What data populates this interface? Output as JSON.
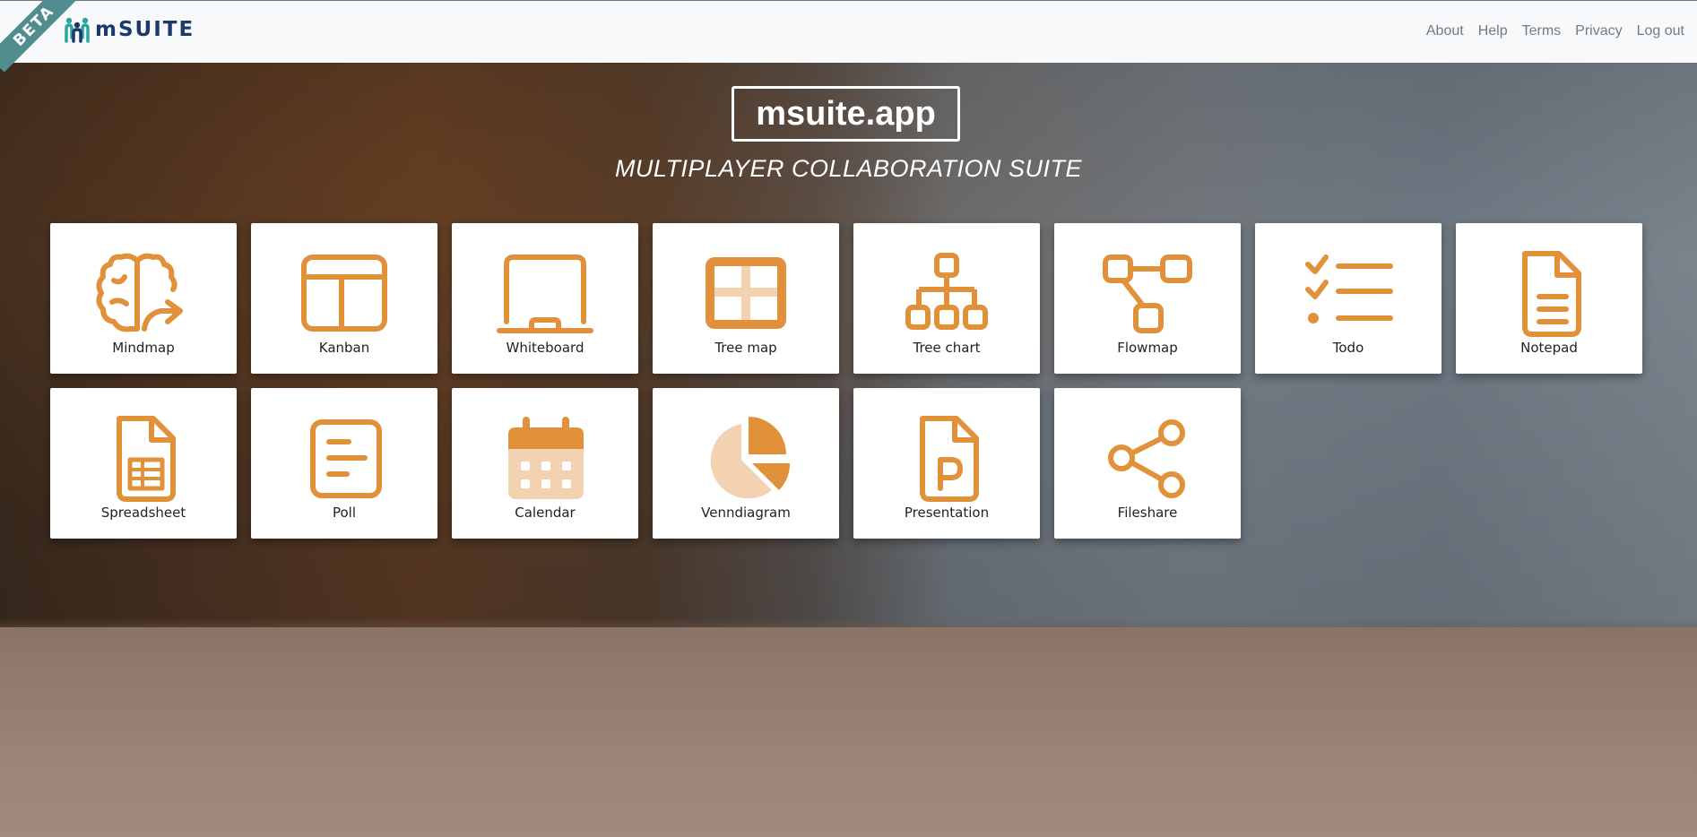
{
  "header": {
    "ribbon": "BETA",
    "logo_text": "mSUITE",
    "logo_icon": "people-logo-icon",
    "nav": [
      "About",
      "Help",
      "Terms",
      "Privacy",
      "Log out"
    ]
  },
  "hero": {
    "title": "msuite.app",
    "tagline": "MULTIPLAYER COLLABORATION SUITE"
  },
  "colors": {
    "accent": "#e0913a",
    "accent_light": "#f3d2b2",
    "brand": "#1b3a6b",
    "brand_teal": "#2aa6a1"
  },
  "apps": [
    {
      "label": "Mindmap",
      "icon": "brain-icon"
    },
    {
      "label": "Kanban",
      "icon": "kanban-board-icon"
    },
    {
      "label": "Whiteboard",
      "icon": "whiteboard-icon"
    },
    {
      "label": "Tree map",
      "icon": "treemap-icon"
    },
    {
      "label": "Tree chart",
      "icon": "tree-chart-icon"
    },
    {
      "label": "Flowmap",
      "icon": "flowmap-icon"
    },
    {
      "label": "Todo",
      "icon": "checklist-icon"
    },
    {
      "label": "Notepad",
      "icon": "document-icon"
    },
    {
      "label": "Spreadsheet",
      "icon": "spreadsheet-icon"
    },
    {
      "label": "Poll",
      "icon": "poll-icon"
    },
    {
      "label": "Calendar",
      "icon": "calendar-icon"
    },
    {
      "label": "Venndiagram",
      "icon": "pie-chart-icon"
    },
    {
      "label": "Presentation",
      "icon": "presentation-file-icon"
    },
    {
      "label": "Fileshare",
      "icon": "share-icon"
    }
  ]
}
